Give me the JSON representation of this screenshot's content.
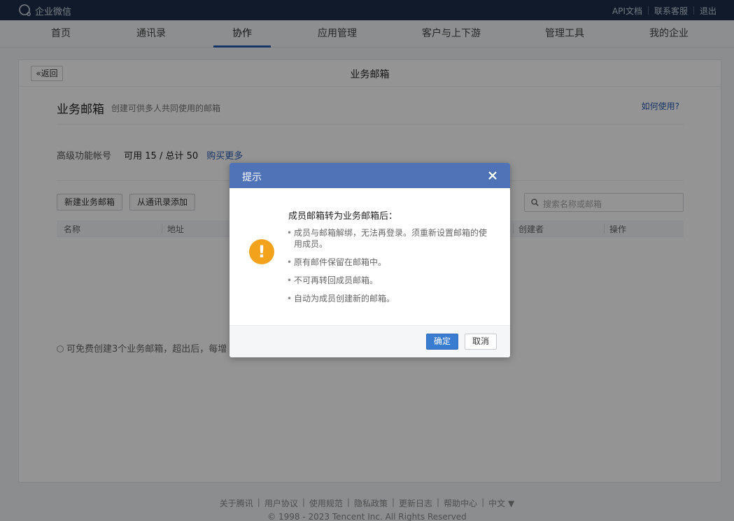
{
  "topbar": {
    "brand": "企业微信",
    "links": [
      "API文档",
      "联系客服",
      "退出"
    ]
  },
  "nav": {
    "items": [
      "首页",
      "通讯录",
      "协作",
      "应用管理",
      "客户与上下游",
      "管理工具",
      "我的企业"
    ],
    "active": "协作"
  },
  "page": {
    "back_label": "«返回",
    "title": "业务邮箱"
  },
  "section": {
    "title": "业务邮箱",
    "description": "创建可供多人共同使用的邮箱",
    "help_link": "如何使用?"
  },
  "quota": {
    "label": "高级功能帐号",
    "value": "可用 15 / 总计 50",
    "buy_link": "购买更多"
  },
  "toolbar": {
    "new_button": "新建业务邮箱",
    "add_button": "从通讯录添加",
    "search_placeholder": "搜索名称或邮箱"
  },
  "table": {
    "columns": [
      "名称",
      "地址",
      "创建者",
      "操作"
    ]
  },
  "note": "可免费创建3个业务邮箱，超出后，每增",
  "footer": {
    "links": [
      "关于腾讯",
      "用户协议",
      "使用规范",
      "隐私政策",
      "更新日志",
      "帮助中心",
      "中文 ▼"
    ],
    "copyright": "© 1998 - 2023 Tencent Inc. All Rights Reserved"
  },
  "dialog": {
    "title": "提示",
    "heading": "成员邮箱转为业务邮箱后：",
    "items": [
      "成员与邮箱解绑，无法再登录。须重新设置邮箱的使用成员。",
      "原有邮件保留在邮箱中。",
      "不可再转回成员邮箱。",
      "自动为成员创建新的邮箱。"
    ],
    "confirm": "确定",
    "cancel": "取消"
  },
  "colors": {
    "topbar": "#1d2e4a",
    "accent": "#2a5bb2",
    "dialog_header": "#4f73b6",
    "warning": "#f3a21b",
    "confirm_button": "#3a7dd0"
  }
}
